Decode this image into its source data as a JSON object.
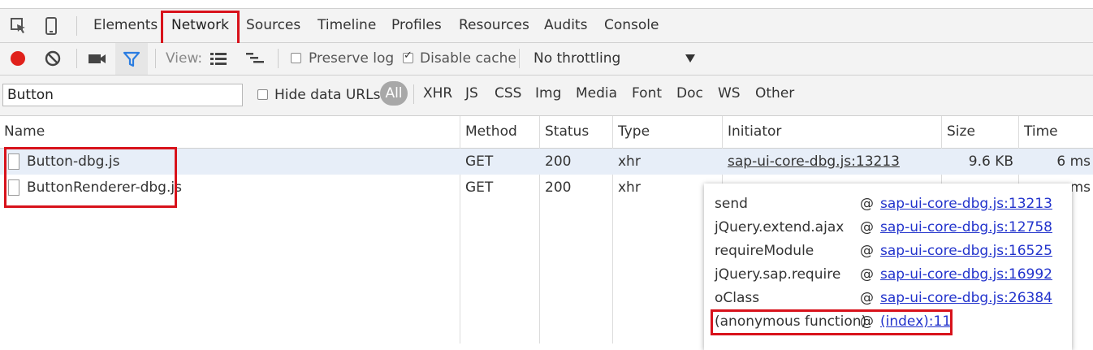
{
  "tabs": [
    "Elements",
    "Network",
    "Sources",
    "Timeline",
    "Profiles",
    "Resources",
    "Audits",
    "Console"
  ],
  "selected_tab": "Network",
  "toolbar": {
    "view_label": "View:",
    "preserve_log": "Preserve log",
    "disable_cache": "Disable cache",
    "throttling": "No throttling"
  },
  "filter": {
    "search_value": "Button",
    "hide_data_urls": "Hide data URLs",
    "all": "All",
    "types": [
      "XHR",
      "JS",
      "CSS",
      "Img",
      "Media",
      "Font",
      "Doc",
      "WS",
      "Other"
    ]
  },
  "columns": {
    "name": "Name",
    "method": "Method",
    "status": "Status",
    "type": "Type",
    "initiator": "Initiator",
    "size": "Size",
    "time": "Time"
  },
  "rows": [
    {
      "name": "Button-dbg.js",
      "method": "GET",
      "status": "200",
      "type": "xhr",
      "initiator": "sap-ui-core-dbg.js:13213",
      "size": "9.6 KB",
      "time": "6 ms"
    },
    {
      "name": "ButtonRenderer-dbg.js",
      "method": "GET",
      "status": "200",
      "type": "xhr",
      "time_partial": "ms"
    }
  ],
  "popover": {
    "frames": [
      {
        "fn": "send",
        "at": "@",
        "link": "sap-ui-core-dbg.js:13213"
      },
      {
        "fn": "jQuery.extend.ajax",
        "at": "@",
        "link": "sap-ui-core-dbg.js:12758"
      },
      {
        "fn": "requireModule",
        "at": "@",
        "link": "sap-ui-core-dbg.js:16525"
      },
      {
        "fn": "jQuery.sap.require",
        "at": "@",
        "link": "sap-ui-core-dbg.js:16992"
      },
      {
        "fn": "oClass",
        "at": "@",
        "link": "sap-ui-core-dbg.js:26384"
      },
      {
        "fn": "(anonymous function)",
        "at": "@",
        "link": "(index):11"
      }
    ]
  },
  "colors": {
    "record": "#e0211b",
    "filter_active": "#2b7de1",
    "highlight_box": "#d8121b",
    "link": "#2233cc",
    "selected_row": "#e7eef8"
  },
  "icons": [
    "inspect-icon",
    "device-mode-icon",
    "record-icon",
    "clear-icon",
    "camera-icon",
    "filter-icon",
    "large-rows-icon",
    "overview-icon",
    "dropdown-arrow-icon",
    "file-icon"
  ]
}
